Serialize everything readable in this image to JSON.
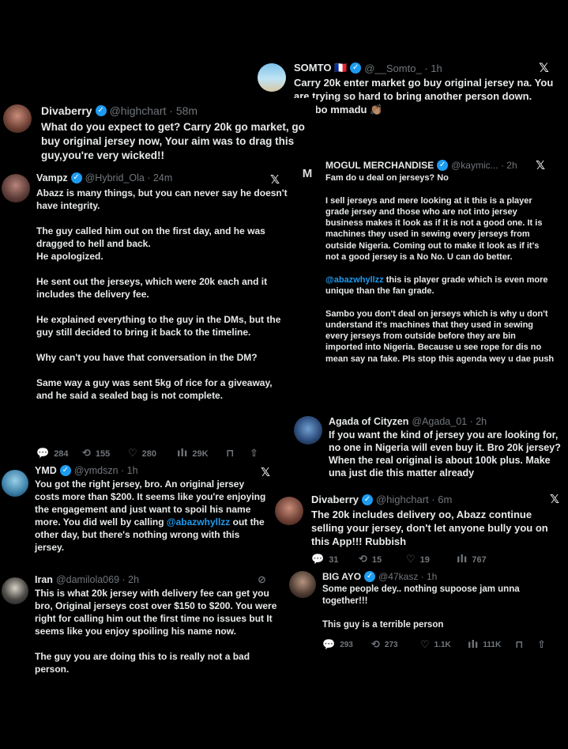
{
  "posts": {
    "somto": {
      "name": "SOMTO 🇫🇷",
      "handle": "@__Somto_ · 1h",
      "text": "Carry 20k enter market go buy original jersey na. You are trying so hard to bring another person down. Ezigbo mmadu 👏🏽"
    },
    "divaberry1": {
      "name": "Divaberry",
      "handle": "@highchart · 58m",
      "text": "What do you expect to get? Carry 20k go market, go buy original jersey now, Your aim was to drag this guy,you're very wicked!!"
    },
    "vampz": {
      "name": "Vampz",
      "handle": "@Hybrid_Ola · 24m",
      "text": "Abazz is many things, but you can never say he doesn't have integrity.\n\nThe guy called him out on the first day, and he was dragged to hell and back.\nHe apologized.\n\nHe sent out the jerseys, which were 20k each and it includes the delivery fee.\n\nHe explained everything to the guy in the DMs, but the guy still decided to bring it back to the timeline.\n\nWhy can't you have that conversation in the DM?\n\nSame way a guy was sent 5kg of rice for a giveaway, and he said a sealed bag is not complete.",
      "replies": "284",
      "reposts": "155",
      "likes": "280",
      "views": "29K"
    },
    "mogul": {
      "name": "MOGUL MERCHANDISE",
      "handle": "@kaymic... · 2h",
      "text_part1": "Fam do u deal on jerseys? No\n\nI sell jerseys and mere looking at it this is a player grade jersey and those who are not into jersey business makes it look as if it is not a good one. It is machines they used in sewing every jerseys from outside Nigeria. Coming out to make it look as if it's not a good jersey is a No No. U can do better.\n\n",
      "mention": "@abazwhyllzz",
      "text_part2": " this is player grade which is even more unique than the fan grade.\n\nSambo you don't deal on jerseys which is why u don't understand it's machines that they used in sewing every jerseys from outside before they are bin imported into Nigeria. Because u see rope for dis no mean say na fake. Pls stop this agenda wey u dae push"
    },
    "agada": {
      "name": "Agada of Cityzen",
      "handle": "@Agada_01 · 2h",
      "text": "If you want the kind of jersey you are looking for, no one in Nigeria will even buy it. Bro 20k jersey? When the real original is about 100k plus. Make una just die this matter already"
    },
    "ymd": {
      "name": "YMD",
      "handle": "@ymdszn · 1h",
      "text_part1": "You got the right jersey, bro. An original jersey costs more than $200. It seems like you're enjoying the engagement and just want to spoil his name more. You did well by calling ",
      "mention": "@abazwhyllzz",
      "text_part2": " out the other day, but there's nothing wrong with this jersey."
    },
    "divaberry2": {
      "name": "Divaberry",
      "handle": "@highchart · 6m",
      "text": "The 20k includes delivery oo, Abazz continue selling your jersey, don't let anyone bully you on this App!!! Rubbish",
      "replies": "31",
      "reposts": "15",
      "likes": "19",
      "views": "767"
    },
    "iran": {
      "name": "Iran",
      "handle": "@damilola069 · 2h",
      "text": "This is what 20k jersey with delivery fee can get you bro, Original jerseys cost over $150 to $200. You were right for calling him out the first time no issues but It seems like you enjoy spoiling his name now.\n\nThe guy you are doing this to is really not a bad person."
    },
    "bigayo": {
      "name": "BIG AYO",
      "handle": "@47kasz · 1h",
      "text": "Some people dey.. nothing supoose jam unna together!!!\n\nThis guy is a terrible person",
      "replies": "293",
      "reposts": "273",
      "likes": "1.1K",
      "views": "111K"
    }
  },
  "icons": {
    "close": "𝕏",
    "reply": "💬",
    "repost": "⟲",
    "like": "♡",
    "views": "ılı",
    "bookmark": "⊓",
    "share": "⇧",
    "verified": "✓",
    "grok": "⊘"
  },
  "colors": {
    "accent": "#1d9bf0",
    "muted": "#71767b",
    "text": "#e7e9ea",
    "background": "#000000"
  }
}
